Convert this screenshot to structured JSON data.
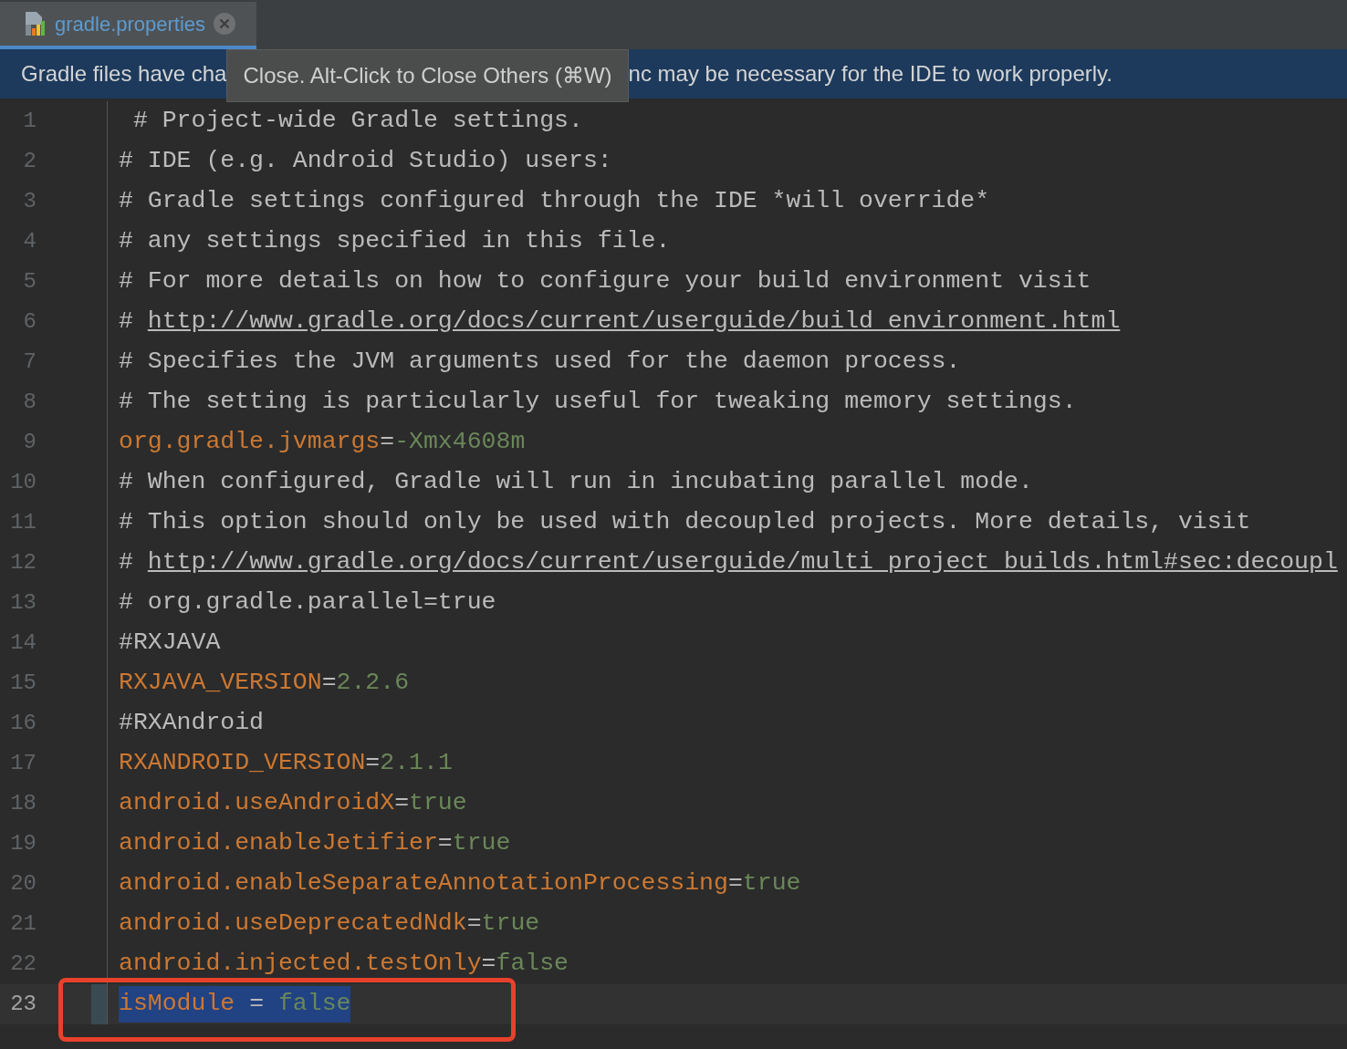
{
  "tabs": [
    {
      "label": "gradle.properties",
      "selected": true
    }
  ],
  "banner": {
    "text_before": "Gradle files have cha",
    "text_after": "nc may be necessary for the IDE to work properly."
  },
  "tooltip": {
    "text": "Close. Alt-Click to Close Others (⌘W)"
  },
  "editor": {
    "lines": [
      {
        "number": "1",
        "kind": "comment",
        "text": " # Project-wide Gradle settings."
      },
      {
        "number": "2",
        "kind": "comment",
        "text": "# IDE (e.g. Android Studio) users:"
      },
      {
        "number": "3",
        "kind": "comment",
        "text": "# Gradle settings configured through the IDE *will override*"
      },
      {
        "number": "4",
        "kind": "comment",
        "text": "# any settings specified in this file."
      },
      {
        "number": "5",
        "kind": "comment",
        "text": "# For more details on how to configure your build environment visit"
      },
      {
        "number": "6",
        "kind": "link",
        "prefix": "# ",
        "text": "http://www.gradle.org/docs/current/userguide/build_environment.html"
      },
      {
        "number": "7",
        "kind": "comment",
        "text": "# Specifies the JVM arguments used for the daemon process."
      },
      {
        "number": "8",
        "kind": "comment",
        "text": "# The setting is particularly useful for tweaking memory settings."
      },
      {
        "number": "9",
        "kind": "property",
        "key": "org.gradle.jvmargs",
        "sep": "=",
        "value": "-Xmx4608m"
      },
      {
        "number": "10",
        "kind": "comment",
        "text": "# When configured, Gradle will run in incubating parallel mode."
      },
      {
        "number": "11",
        "kind": "comment",
        "text": "# This option should only be used with decoupled projects. More details, visit"
      },
      {
        "number": "12",
        "kind": "link",
        "prefix": "# ",
        "text": "http://www.gradle.org/docs/current/userguide/multi_project_builds.html#sec:decoupl"
      },
      {
        "number": "13",
        "kind": "comment",
        "text": "# org.gradle.parallel=true"
      },
      {
        "number": "14",
        "kind": "comment",
        "text": "#RXJAVA"
      },
      {
        "number": "15",
        "kind": "property",
        "key": "RXJAVA_VERSION",
        "sep": "=",
        "value": "2.2.6"
      },
      {
        "number": "16",
        "kind": "comment",
        "text": "#RXAndroid"
      },
      {
        "number": "17",
        "kind": "property",
        "key": "RXANDROID_VERSION",
        "sep": "=",
        "value": "2.1.1"
      },
      {
        "number": "18",
        "kind": "property",
        "key": "android.useAndroidX",
        "sep": "=",
        "value": "true"
      },
      {
        "number": "19",
        "kind": "property",
        "key": "android.enableJetifier",
        "sep": "=",
        "value": "true"
      },
      {
        "number": "20",
        "kind": "property",
        "key": "android.enableSeparateAnnotationProcessing",
        "sep": "=",
        "value": "true"
      },
      {
        "number": "21",
        "kind": "property",
        "key": "android.useDeprecatedNdk",
        "sep": "=",
        "value": "true"
      },
      {
        "number": "22",
        "kind": "property",
        "key": "android.injected.testOnly",
        "sep": "=",
        "value": "false"
      },
      {
        "number": "23",
        "kind": "property",
        "key": "isModule",
        "sep": " = ",
        "value": "false",
        "current": true,
        "selected": true
      }
    ]
  }
}
